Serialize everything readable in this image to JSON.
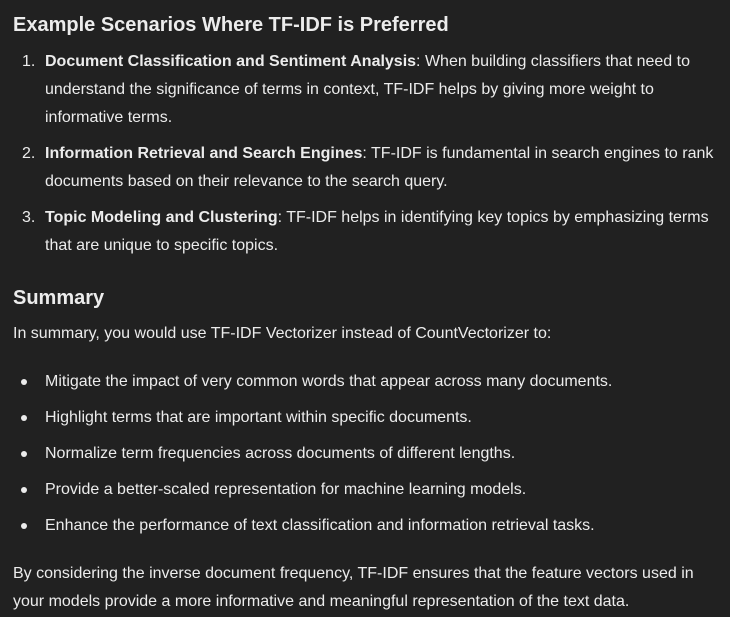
{
  "scenarios_heading": "Example Scenarios Where TF-IDF is Preferred",
  "scenarios": [
    {
      "number": "1.",
      "title": "Document Classification and Sentiment Analysis",
      "text": ": When building classifiers that need to understand the significance of terms in context, TF-IDF helps by giving more weight to informative terms."
    },
    {
      "number": "2.",
      "title": "Information Retrieval and Search Engines",
      "text": ": TF-IDF is fundamental in search engines to rank documents based on their relevance to the search query."
    },
    {
      "number": "3.",
      "title": "Topic Modeling and Clustering",
      "text": ": TF-IDF helps in identifying key topics by emphasizing terms that are unique to specific topics."
    }
  ],
  "summary_heading": "Summary",
  "summary_intro": "In summary, you would use TF-IDF Vectorizer instead of CountVectorizer to:",
  "summary_points": [
    "Mitigate the impact of very common words that appear across many documents.",
    "Highlight terms that are important within specific documents.",
    "Normalize term frequencies across documents of different lengths.",
    "Provide a better-scaled representation for machine learning models.",
    "Enhance the performance of text classification and information retrieval tasks."
  ],
  "closing": "By considering the inverse document frequency, TF-IDF ensures that the feature vectors used in your models provide a more informative and meaningful representation of the text data."
}
